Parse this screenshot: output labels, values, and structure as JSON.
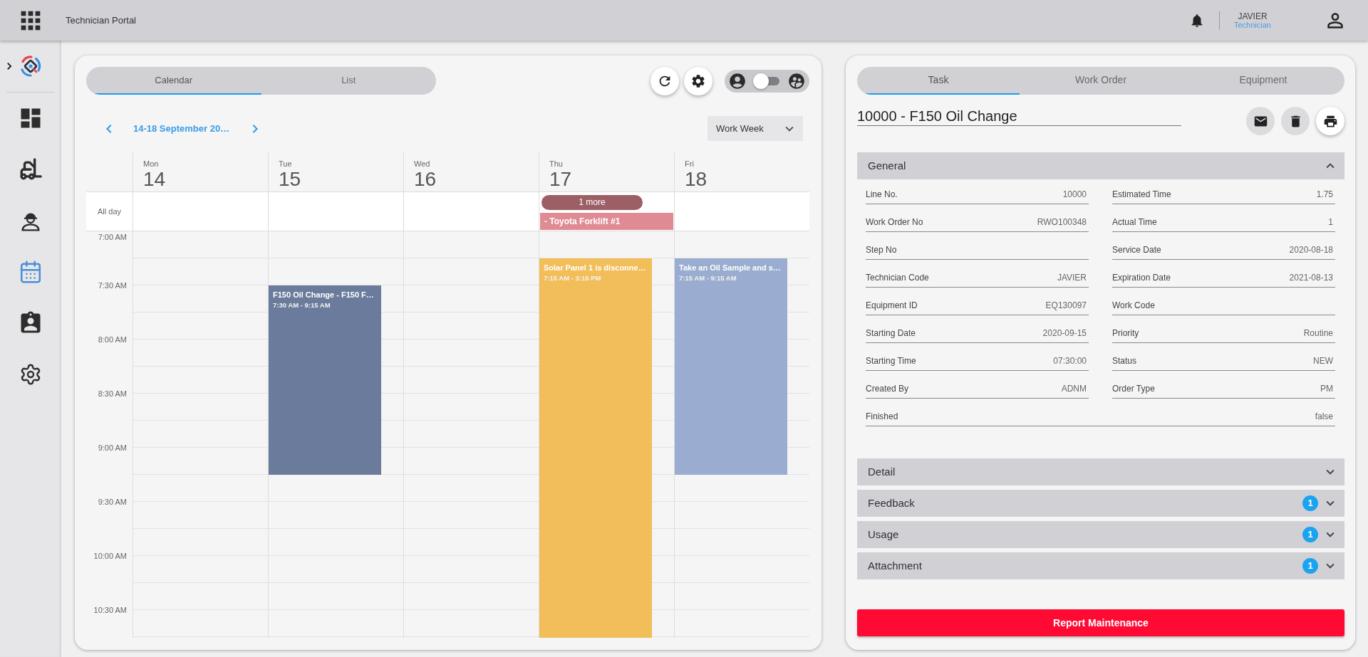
{
  "top_bar": {
    "title": "Technician Portal",
    "user_name": "JAVIER",
    "user_role": "Technician"
  },
  "sidebar": {
    "expanded": false,
    "items": [
      {
        "selected": false
      },
      {
        "selected": false
      },
      {
        "selected": false
      },
      {
        "selected": true
      },
      {
        "selected": false
      },
      {
        "selected": false
      }
    ]
  },
  "calendar": {
    "tabs": [
      {
        "label": "Calendar",
        "selected": true
      },
      {
        "label": "List",
        "selected": false
      }
    ],
    "toggle": {
      "on": false
    },
    "date_range": "14-18 September 20…",
    "view": "Work Week",
    "all_day_label": "All day",
    "time_labels": [
      "7:00 AM",
      "7:30 AM",
      "8:00 AM",
      "8:30 AM",
      "9:00 AM",
      "9:30 AM",
      "10:00 AM",
      "10:30 AM"
    ],
    "days": [
      {
        "weekday": "Mon",
        "date": "14"
      },
      {
        "weekday": "Tue",
        "date": "15",
        "events": [
          {
            "title": "F150 Oil Change - F150 F…",
            "time": "7:30 AM - 9:15 AM",
            "color": "#6a7b9c"
          }
        ]
      },
      {
        "weekday": "Wed",
        "date": "16"
      },
      {
        "weekday": "Thu",
        "date": "17",
        "all_day_more": "1 more",
        "all_day_events": [
          {
            "title": "- Toyota Forklift #1",
            "color": "#e08a93"
          }
        ],
        "events": [
          {
            "title": "Solar Panel 1 is disconne…",
            "time": "7:15 AM - 3:15 PM",
            "color": "#f2be5a"
          }
        ]
      },
      {
        "weekday": "Fri",
        "date": "18",
        "events": [
          {
            "title": "Take an Oil Sample and s…",
            "time": "7:15 AM - 9:15 AM",
            "color": "#9aadd0"
          }
        ]
      }
    ]
  },
  "task_panel": {
    "tabs": [
      {
        "label": "Task",
        "selected": true
      },
      {
        "label": "Work Order",
        "selected": false
      },
      {
        "label": "Equipment",
        "selected": false
      }
    ],
    "title": "10000 - F150 Oil Change",
    "sections": [
      {
        "title": "General",
        "expanded": true,
        "rows": [
          [
            {
              "label": "Line No.",
              "value": "10000"
            },
            {
              "label": "Estimated Time",
              "value": "1.75"
            }
          ],
          [
            {
              "label": "Work Order No",
              "value": "RWO100348"
            },
            {
              "label": "Actual Time",
              "value": "1"
            }
          ],
          [
            {
              "label": "Step No"
            },
            {
              "label": "Service Date",
              "value": "2020-08-18"
            }
          ],
          [
            {
              "label": "Technician Code",
              "value": "JAVIER"
            },
            {
              "label": "Expiration Date",
              "value": "2021-08-13"
            }
          ],
          [
            {
              "label": "Equipment ID",
              "value": "EQ130097"
            },
            {
              "label": "Work Code"
            }
          ],
          [
            {
              "label": "Starting Date",
              "value": "2020-09-15"
            },
            {
              "label": "Priority",
              "value": "Routine"
            }
          ],
          [
            {
              "label": "Starting Time",
              "value": "07:30:00"
            },
            {
              "label": "Status",
              "value": "NEW"
            }
          ],
          [
            {
              "label": "Created By",
              "value": "ADNM"
            },
            {
              "label": "Order Type",
              "value": "PM"
            }
          ],
          [
            {
              "label": "Finished",
              "value": "false"
            }
          ]
        ]
      },
      {
        "title": "Detail",
        "expanded": false
      },
      {
        "title": "Feedback",
        "expanded": false,
        "badge": "1"
      },
      {
        "title": "Usage",
        "expanded": false,
        "badge": "1"
      },
      {
        "title": "Attachment",
        "expanded": false,
        "badge": "1"
      }
    ],
    "report_button": "Report Maintenance"
  }
}
